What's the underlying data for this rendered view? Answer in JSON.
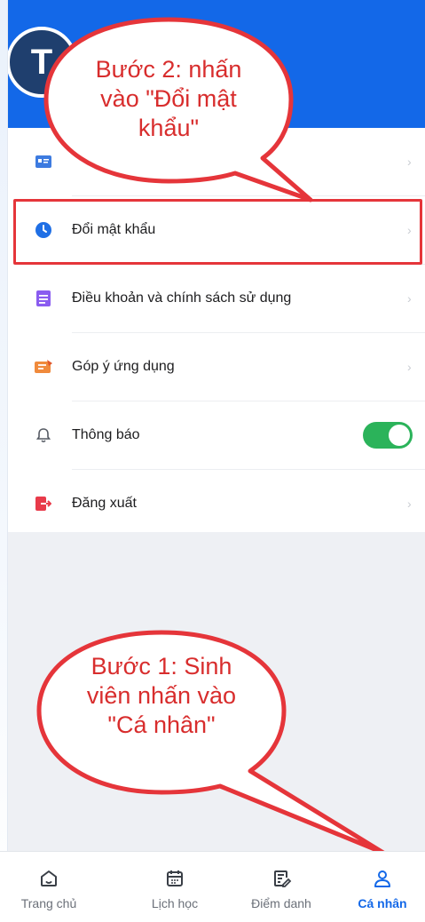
{
  "profile": {
    "avatar_initial": "T"
  },
  "callouts": {
    "step2": [
      "Bước 2: nhấn",
      "vào \"Đổi mật",
      "khẩu\""
    ],
    "step1": [
      "Bước 1: Sinh",
      "viên nhấn vào",
      "\"Cá nhân\""
    ]
  },
  "menu": {
    "items": [
      {
        "label": "",
        "icon": "id-card-icon",
        "chevron": "›",
        "color": "#3d7be0"
      },
      {
        "label": "Đổi mật khẩu",
        "icon": "clock-icon",
        "chevron": "›",
        "color": "#1f6fe5"
      },
      {
        "label": "Điều khoản và chính sách sử dụng",
        "icon": "document-icon",
        "chevron": "›",
        "color": "#8a5cf0"
      },
      {
        "label": "Góp ý ứng dụng",
        "icon": "feedback-icon",
        "chevron": "›",
        "color": "#f08a3c"
      },
      {
        "label": "Thông báo",
        "icon": "bell-icon",
        "toggle": "on",
        "color": "#555a63"
      },
      {
        "label": "Đăng xuất",
        "icon": "logout-icon",
        "chevron": "›",
        "color": "#e83a4a"
      }
    ]
  },
  "bottom_nav": {
    "items": [
      {
        "label": "Trang chủ",
        "icon": "home-icon"
      },
      {
        "label": "Lịch học",
        "icon": "calendar-icon"
      },
      {
        "label": "Điểm danh",
        "icon": "attendance-icon"
      },
      {
        "label": "Cá nhân",
        "icon": "person-icon",
        "active": true
      }
    ]
  },
  "colors": {
    "header": "#1368e8",
    "toggle_on": "#2bb35a",
    "annotation_red": "#e5353a",
    "active_tab": "#1368e8"
  }
}
